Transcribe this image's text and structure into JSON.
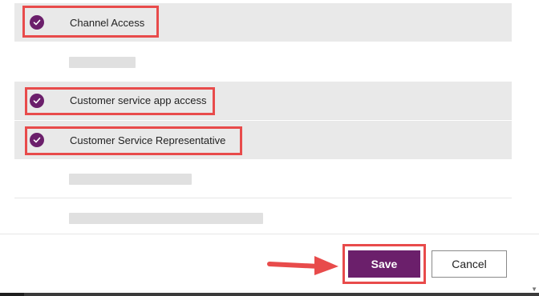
{
  "roles": [
    {
      "label": "Channel Access",
      "selected": true
    },
    {
      "label": "",
      "selected": false
    },
    {
      "label": "Customer service app access",
      "selected": true
    },
    {
      "label": "Customer Service Representative",
      "selected": true
    },
    {
      "label": "",
      "selected": false
    },
    {
      "label": "",
      "selected": false
    }
  ],
  "footer": {
    "save_label": "Save",
    "cancel_label": "Cancel"
  },
  "colors": {
    "accent": "#6b1f6b",
    "highlight": "#e84b4b",
    "selected_row": "#e9e9e9"
  },
  "icons": {
    "check": "checkmark-icon",
    "arrow": "arrow-right-icon"
  }
}
